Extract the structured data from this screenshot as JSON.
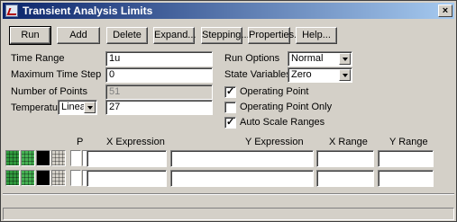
{
  "window": {
    "title": "Transient Analysis Limits",
    "close_glyph": "×"
  },
  "toolbar": {
    "run": "Run",
    "add": "Add",
    "delete": "Delete",
    "expand": "Expand...",
    "stepping": "Stepping...",
    "properties": "Properties...",
    "help": "Help..."
  },
  "form": {
    "time_range_label": "Time Range",
    "time_range_value": "1u",
    "max_time_step_label": "Maximum Time Step",
    "max_time_step_value": "0",
    "num_points_label": "Number of Points",
    "num_points_value": "51",
    "temperature_label": "Temperature",
    "temperature_mode": "Linear",
    "temperature_value": "27",
    "run_options_label": "Run Options",
    "run_options_value": "Normal",
    "state_variables_label": "State Variables",
    "state_variables_value": "Zero",
    "operating_point_label": "Operating Point",
    "operating_point_checked": true,
    "operating_point_only_label": "Operating Point Only",
    "operating_point_only_checked": false,
    "auto_scale_label": "Auto Scale Ranges",
    "auto_scale_checked": true
  },
  "table": {
    "headers": {
      "p": "P",
      "x_expr": "X Expression",
      "y_expr": "Y Expression",
      "x_range": "X Range",
      "y_range": "Y Range"
    },
    "rows": [
      {
        "p": "",
        "x_expr": "",
        "y_expr": "",
        "x_range": "",
        "y_range": ""
      },
      {
        "p": "",
        "x_expr": "",
        "y_expr": "",
        "x_range": "",
        "y_range": ""
      }
    ],
    "icon_colors": {
      "grid_green": "#2f9a3e",
      "grid_green_light": "#45b153",
      "black": "#000000",
      "table_gray": "#d4d0c8"
    }
  }
}
